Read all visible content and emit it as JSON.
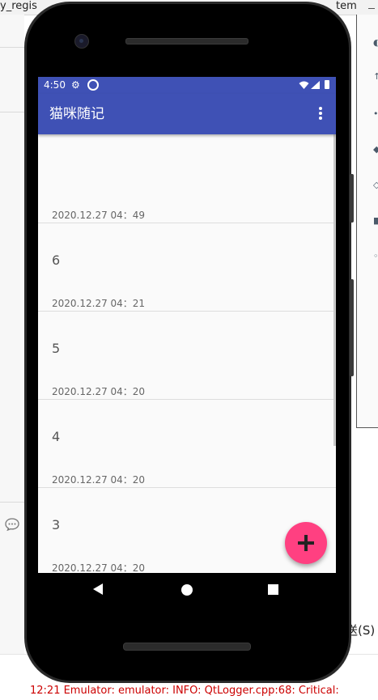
{
  "background": {
    "top_bar_left_text": "y_regis",
    "top_bar_right_text": "tem",
    "send_label": "送(S)",
    "log_line": "12:21  Emulator: emulator: INFO: QtLogger.cpp:68: Critical:"
  },
  "statusbar": {
    "time": "4:50"
  },
  "toolbar": {
    "title": "猫咪随记"
  },
  "notes": [
    {
      "title": "",
      "date": "2020.12.27 04：49"
    },
    {
      "title": "6",
      "date": "2020.12.27 04：21"
    },
    {
      "title": "5",
      "date": "2020.12.27 04：20"
    },
    {
      "title": "4",
      "date": "2020.12.27 04：20"
    },
    {
      "title": "3",
      "date": "2020.12.27 04：20"
    }
  ],
  "colors": {
    "primary": "#3f51b5",
    "accent": "#ff4081",
    "log_text": "#cc0000"
  },
  "icons": {
    "overflow": "overflow-menu-icon",
    "fab": "add-icon",
    "nav_back": "back-icon",
    "nav_home": "home-icon",
    "nav_recent": "recent-apps-icon"
  }
}
